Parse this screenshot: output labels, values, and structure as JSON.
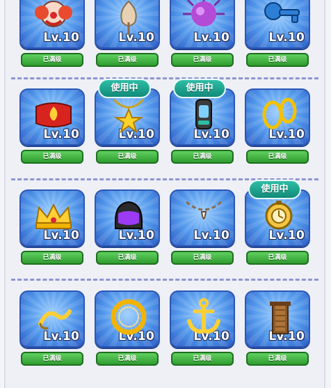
{
  "cards": [
    {
      "level": "Lv.10",
      "button": "已满级",
      "badge": "",
      "icon": "clown-mask-icon"
    },
    {
      "level": "Lv.10",
      "button": "已满级",
      "badge": "",
      "icon": "onion-pendant-icon"
    },
    {
      "level": "Lv.10",
      "button": "已满级",
      "badge": "",
      "icon": "purple-sea-urchin-icon"
    },
    {
      "level": "Lv.10",
      "button": "已满级",
      "badge": "",
      "icon": "blue-key-icon"
    },
    {
      "level": "Lv.10",
      "button": "已满级",
      "badge": "",
      "icon": "fire-wristband-icon"
    },
    {
      "level": "Lv.10",
      "button": "已满级",
      "badge": "使用中",
      "icon": "star-necklace-icon"
    },
    {
      "level": "Lv.10",
      "button": "已满级",
      "badge": "使用中",
      "icon": "smartwatch-icon"
    },
    {
      "level": "Lv.10",
      "button": "已满级",
      "badge": "",
      "icon": "gold-earrings-icon"
    },
    {
      "level": "Lv.10",
      "button": "已满级",
      "badge": "",
      "icon": "crown-icon"
    },
    {
      "level": "Lv.10",
      "button": "已满级",
      "badge": "",
      "icon": "helmet-icon"
    },
    {
      "level": "Lv.10",
      "button": "已满级",
      "badge": "",
      "icon": "tooth-necklace-icon"
    },
    {
      "level": "Lv.10",
      "button": "已满级",
      "badge": "使用中",
      "icon": "pocket-watch-icon"
    },
    {
      "level": "Lv.10",
      "button": "已满级",
      "badge": "",
      "icon": "gold-scroll-icon"
    },
    {
      "level": "Lv.10",
      "button": "已满级",
      "badge": "",
      "icon": "gold-ring-icon"
    },
    {
      "level": "Lv.10",
      "button": "已满级",
      "badge": "",
      "icon": "anchor-icon"
    },
    {
      "level": "Lv.10",
      "button": "已满级",
      "badge": "",
      "icon": "skyscraper-icon"
    }
  ]
}
